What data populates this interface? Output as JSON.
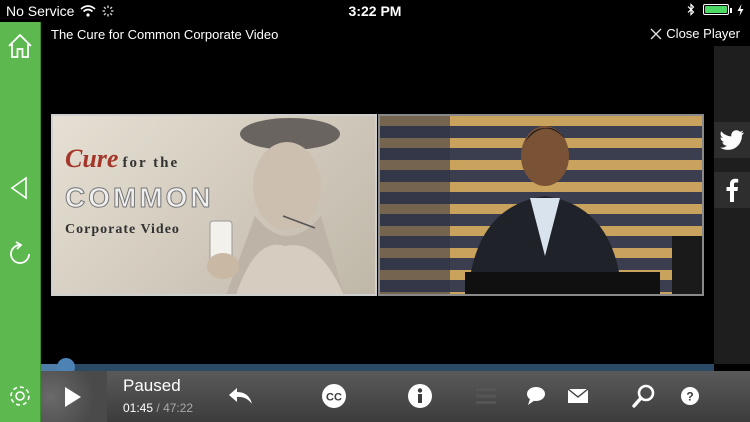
{
  "status_bar": {
    "carrier": "No Service",
    "time": "3:22 PM",
    "battery_level": 1.0,
    "battery_color": "#4cd964"
  },
  "sidebar": {
    "color": "#5cb84f",
    "icons": [
      "home-icon",
      "back-triangle-icon",
      "refresh-icon",
      "settings-gear-icon"
    ]
  },
  "player": {
    "title": "The Cure for Common Corporate Video",
    "close_label": "Close Player"
  },
  "slide": {
    "word1": "Cure",
    "rest1": "for the",
    "word2": "COMMON",
    "word3": "Corporate Video"
  },
  "share": {
    "icons": [
      "twitter-icon",
      "facebook-icon"
    ]
  },
  "playback": {
    "state": "Paused",
    "current_time": "01:45",
    "separator": "/",
    "duration": "47:22",
    "progress": 0.037,
    "progress_color": "#4d7fa8"
  },
  "controls": {
    "icons": [
      "play-icon",
      "rewind-icon",
      "closed-caption-icon",
      "info-icon",
      "chapters-list-icon",
      "comment-icon",
      "email-icon",
      "search-icon",
      "help-icon"
    ]
  }
}
